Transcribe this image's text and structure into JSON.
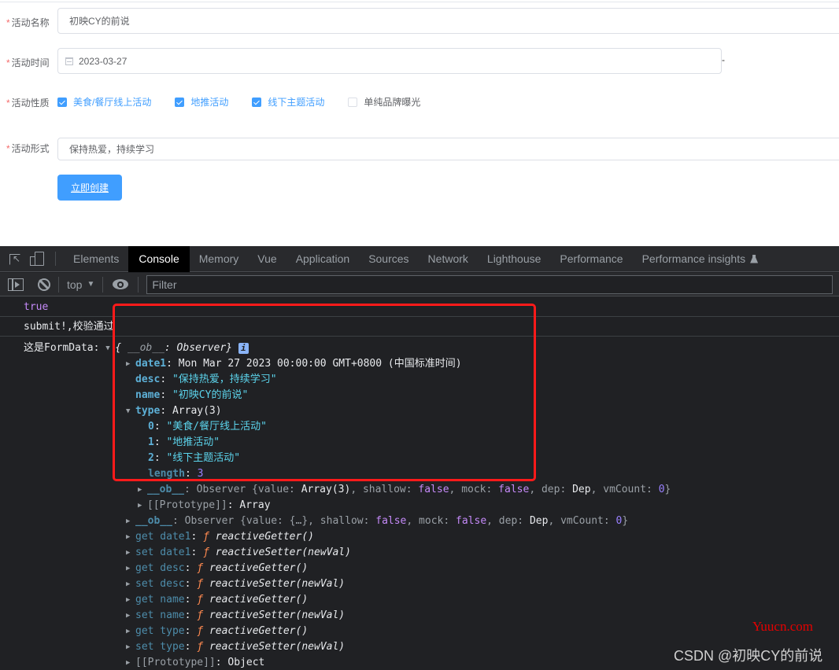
{
  "form": {
    "fields": [
      {
        "label": "活动名称",
        "value": "初映CY的前说"
      },
      {
        "label": "活动时间",
        "value": "2023-03-27",
        "separator": "-"
      },
      {
        "label": "活动性质"
      },
      {
        "label": "活动形式",
        "value": "保持热爱，持续学习"
      }
    ],
    "required_mark": "*",
    "checkboxes": [
      {
        "label": "美食/餐厅线上活动",
        "checked": true
      },
      {
        "label": "地推活动",
        "checked": true
      },
      {
        "label": "线下主题活动",
        "checked": true
      },
      {
        "label": "单纯品牌曝光",
        "checked": false
      }
    ],
    "submit_label": "立即创建"
  },
  "devtools": {
    "tabs": [
      "Elements",
      "Console",
      "Memory",
      "Vue",
      "Application",
      "Sources",
      "Network",
      "Lighthouse",
      "Performance",
      "Performance insights"
    ],
    "active_tab": "Console",
    "context": "top",
    "filter_placeholder": "Filter",
    "console": {
      "msg1": "true",
      "msg2": "submit!,校验通过",
      "msg3_prefix": "这是FormData: ",
      "obj_summary_open": "{",
      "obj_summary_key": "__ob__",
      "obj_summary_val": ": Observer}",
      "info": "i",
      "date1_key": "date1",
      "date1_val": "Mon Mar 27 2023 00:00:00 GMT+0800 (中国标准时间)",
      "desc_key": "desc",
      "desc_val": "\"保持热爱，持续学习\"",
      "name_key": "name",
      "name_val": "\"初映CY的前说\"",
      "type_key": "type",
      "type_val": "Array(3)",
      "type_items": [
        {
          "index": "0",
          "value": "\"美食/餐厅线上活动\""
        },
        {
          "index": "1",
          "value": "\"地推活动\""
        },
        {
          "index": "2",
          "value": "\"线下主题活动\""
        }
      ],
      "length_key": "length",
      "length_val": "3",
      "arr_ob_key": "__ob__",
      "arr_ob_parts": {
        "a": ": Observer {value: ",
        "b": "Array(3)",
        "c": ", shallow: ",
        "d": "false",
        "e": ", mock: ",
        "f": "false",
        "g": ", dep: ",
        "h": "Dep",
        "i": ", vmCount: ",
        "j": "0",
        "k": "}"
      },
      "arr_proto_key": "[[Prototype]]",
      "arr_proto_val": "Array",
      "obj_ob_key": "__ob__",
      "obj_ob_parts": {
        "a": ": Observer {value: {…}, shallow: ",
        "b": "false",
        "c": ", mock: ",
        "d": "false",
        "e": ", dep: ",
        "f": "Dep",
        "g": ", vmCount: ",
        "h": "0",
        "i": "}"
      },
      "accessors": [
        {
          "key": "get date1",
          "fn": "reactiveGetter()"
        },
        {
          "key": "set date1",
          "fn": "reactiveSetter(newVal)"
        },
        {
          "key": "get desc",
          "fn": "reactiveGetter()"
        },
        {
          "key": "set desc",
          "fn": "reactiveSetter(newVal)"
        },
        {
          "key": "get name",
          "fn": "reactiveGetter()"
        },
        {
          "key": "set name",
          "fn": "reactiveSetter(newVal)"
        },
        {
          "key": "get type",
          "fn": "reactiveGetter()"
        },
        {
          "key": "set type",
          "fn": "reactiveSetter(newVal)"
        }
      ],
      "f_glyph": "ƒ",
      "obj_proto_key": "[[Prototype]]",
      "obj_proto_val": "Object"
    }
  },
  "watermarks": {
    "site": "Yuucn.com",
    "author": "CSDN @初映CY的前说"
  },
  "colors": {
    "accent": "#409eff",
    "required": "#f56c6c",
    "highlight_box": "#ff1a1a"
  }
}
